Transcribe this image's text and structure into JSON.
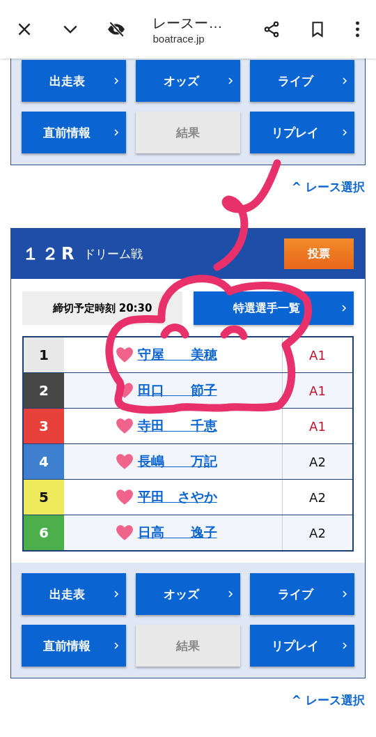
{
  "browser": {
    "title": "レースー…",
    "domain": "boatrace.jp"
  },
  "top_buttons": [
    {
      "label": "出走表",
      "disabled": false
    },
    {
      "label": "オッズ",
      "disabled": false
    },
    {
      "label": "ライブ",
      "disabled": false
    },
    {
      "label": "直前情報",
      "disabled": false
    },
    {
      "label": "結果",
      "disabled": true
    },
    {
      "label": "リプレイ",
      "disabled": false
    }
  ],
  "top_link": {
    "arrow": "^",
    "label": "レース選択"
  },
  "race": {
    "number": "１２R",
    "name": "ドリーム戦",
    "vote_button": "投票",
    "deadline": "締切予定時刻 20:30",
    "players_button": "特選選手一覧",
    "racers": [
      {
        "lane": "1",
        "color": "#e8e8e8",
        "name": "守屋　　美穂",
        "grade": {
          "text": "A1",
          "color": "#c0102a"
        }
      },
      {
        "lane": "2",
        "color": "#474747",
        "name": "田口　　節子",
        "grade": {
          "text": "A1",
          "color": "#c0102a"
        }
      },
      {
        "lane": "3",
        "color": "#e8413c",
        "name": "寺田　　千恵",
        "grade": {
          "text": "A1",
          "color": "#c0102a"
        }
      },
      {
        "lane": "4",
        "color": "#3f7fcf",
        "name": "長嶋　　万記",
        "grade": {
          "text": "A2",
          "color": "#111111"
        }
      },
      {
        "lane": "5",
        "color": "#eeea5c",
        "name": "平田　さやか",
        "grade": {
          "text": "A2",
          "color": "#111111"
        }
      },
      {
        "lane": "6",
        "color": "#4caf4c",
        "name": "日高　　逸子",
        "grade": {
          "text": "A2",
          "color": "#111111"
        }
      }
    ]
  },
  "bottom_buttons": [
    {
      "label": "出走表",
      "disabled": false
    },
    {
      "label": "オッズ",
      "disabled": false
    },
    {
      "label": "ライブ",
      "disabled": false
    },
    {
      "label": "直前情報",
      "disabled": false
    },
    {
      "label": "結果",
      "disabled": true
    },
    {
      "label": "リプレイ",
      "disabled": false
    }
  ],
  "bottom_link": {
    "arrow": "^",
    "label": "レース選択"
  }
}
